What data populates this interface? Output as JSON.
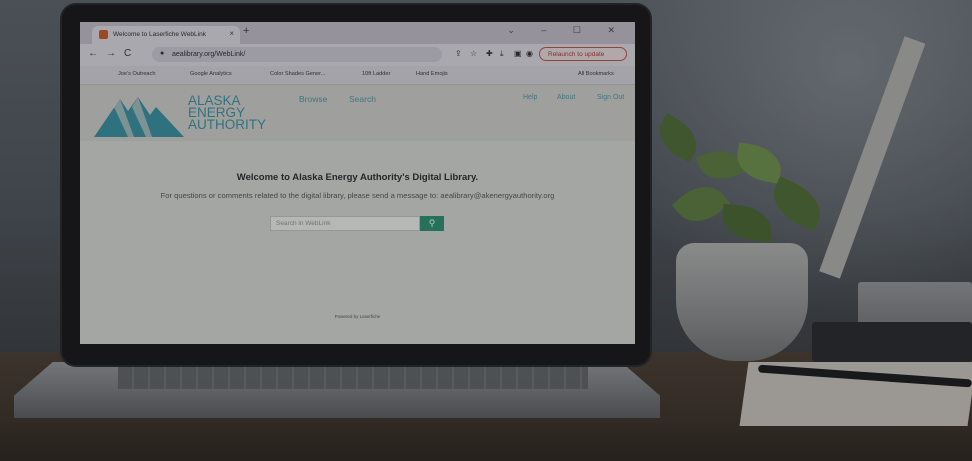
{
  "browser": {
    "tab_title": "Welcome to Laserfiche WebLink",
    "tab_close": "×",
    "new_tab": "+",
    "window_controls": "⌄ – ☐ ✕",
    "url": "aealibrary.org/WebLink/",
    "relaunch_label": "Relaunch to update",
    "bookmarks": [
      "Joe's Outreach",
      "Google Analytics",
      "Color Shades Gener...",
      "10ft Ladder",
      "Hand Emojis"
    ],
    "all_bookmarks": "All Bookmarks"
  },
  "site": {
    "logo_lines": [
      "ALASKA",
      "ENERGY",
      "AUTHORITY"
    ],
    "nav": {
      "browse": "Browse",
      "search": "Search",
      "help": "Help",
      "about": "About",
      "sign_out": "Sign Out"
    },
    "welcome": "Welcome to Alaska Energy Authority's Digital Library.",
    "info": "For questions or comments related to the digital library, please send a message to: aealibrary@akenergyauthority.org",
    "search_placeholder": "Search in WebLink",
    "powered_by": "Powered by Laserfiche"
  },
  "colors": {
    "logo_teal": "#3d8b9b",
    "search_button": "#2f8a71",
    "relaunch_red": "#a43a36"
  }
}
